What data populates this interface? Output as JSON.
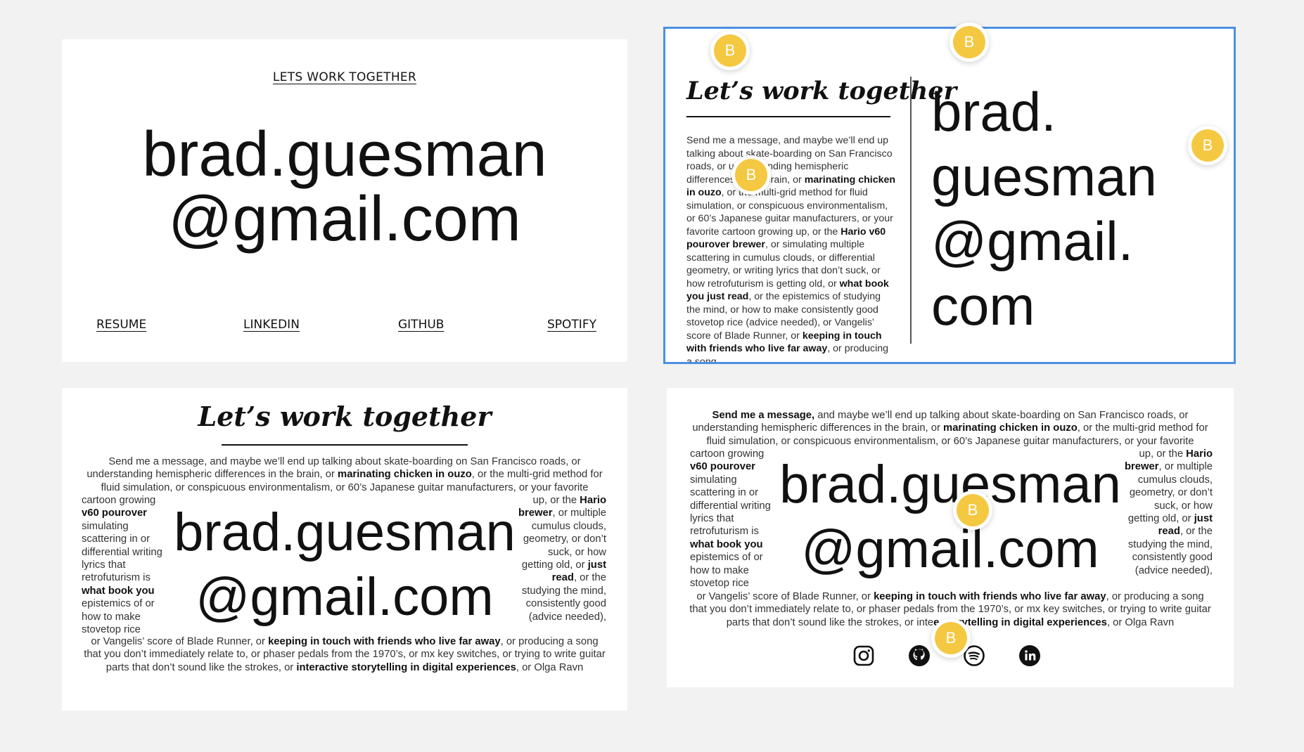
{
  "card1": {
    "top_link": "LETS WORK TOGETHER",
    "email_line1": "brad.guesman",
    "email_line2": "@gmail.com",
    "links": [
      "RESUME",
      "LINKEDIN",
      "GITHUB",
      "SPOTIFY"
    ]
  },
  "card2": {
    "title": "Let’s work together",
    "message": [
      {
        "t": "Send me a message, and maybe we’ll end up talking about skate-boarding on San Francisco roads, or understanding hemispheric differences in the brain, or "
      },
      {
        "b": "marinating chicken in ouzo"
      },
      {
        "t": ", or the multi-grid method for fluid simulation, or conspicuous environmentalism, or 60’s Japanese guitar manufacturers, or your favorite cartoon growing up, or the "
      },
      {
        "b": "Hario v60 pourover brewer"
      },
      {
        "t": ", or simulating multiple scattering in cumulus clouds, or differential geometry, or writing lyrics that don’t suck, or how retrofuturism is getting old, or "
      },
      {
        "b": "what book you just read"
      },
      {
        "t": ", or the epistemics of studying the mind, or how to make consistently good stovetop rice (advice needed), or Vangelis’ score of Blade Runner, or "
      },
      {
        "b": "keeping in touch with friends who live far away"
      },
      {
        "t": ", or producing a song"
      }
    ],
    "email_lines": [
      "brad.",
      "guesman",
      "@gmail.",
      "com"
    ]
  },
  "card3": {
    "title": "Let’s work together",
    "para_top": [
      {
        "t": "Send me a message, and maybe we’ll end up talking about skate-boarding on San Francisco roads, or understanding hemispheric differences in the brain, or "
      },
      {
        "b": "marinating chicken in ouzo"
      },
      {
        "t": ", or the multi-grid method for fluid simulation, or conspicuous environmentalism, or 60’s Japanese guitar manufacturers, or your favorite"
      }
    ],
    "side_left": [
      {
        "t": "cartoon growing "
      },
      {
        "b": "v60 pourover"
      },
      {
        "t": " simulating scattering in or differential writing lyrics that retrofuturism is "
      },
      {
        "b": "what book you"
      },
      {
        "t": " epistemics of or how to make stovetop rice"
      }
    ],
    "side_right": [
      {
        "t": "up, or the "
      },
      {
        "b": "Hario brewer"
      },
      {
        "t": ", or multiple cumulus clouds, geometry, or don’t suck, or how getting old, or "
      },
      {
        "b": "just read"
      },
      {
        "t": ", or the studying the mind, consistently good (advice needed),"
      }
    ],
    "para_bottom": [
      {
        "t": "or Vangelis’ score of Blade Runner, or "
      },
      {
        "b": "keeping in touch with friends who live far away"
      },
      {
        "t": ", or producing a song that you don’t immediately relate to, or phaser pedals from the 1970’s, or mx key switches, or trying to write guitar parts that don’t sound like the strokes, or "
      },
      {
        "b": "interactive storytelling in digital experiences"
      },
      {
        "t": ", or Olga Ravn"
      }
    ],
    "email_line1": "brad.guesman",
    "email_line2": "@gmail.com"
  },
  "card4": {
    "para_top": [
      {
        "b": "Send me a message,"
      },
      {
        "t": " and maybe we’ll end up talking about skate-boarding on San Francisco roads, or understanding hemispheric differences in the brain, or "
      },
      {
        "b": "marinating chicken in ouzo"
      },
      {
        "t": ", or the multi-grid method for fluid simulation, or conspicuous environmentalism, or 60’s Japanese guitar manufacturers, or your favorite"
      }
    ],
    "side_left": [
      {
        "t": "cartoon growing "
      },
      {
        "b": "v60 pourover"
      },
      {
        "t": " simulating scattering in or differential writing lyrics that retrofuturism is "
      },
      {
        "b": "what book you"
      },
      {
        "t": " epistemics of or how to make stovetop rice"
      }
    ],
    "side_right": [
      {
        "t": "up, or the "
      },
      {
        "b": "Hario brewer"
      },
      {
        "t": ", or multiple cumulus clouds, geometry, or don’t suck, or how getting old, or "
      },
      {
        "b": "just read"
      },
      {
        "t": ", or the studying the mind, consistently good (advice needed),"
      }
    ],
    "para_bottom": [
      {
        "t": "or Vangelis’ score of Blade Runner, or "
      },
      {
        "b": "keeping in touch with friends who live far away"
      },
      {
        "t": ", or producing a song that you don’t immediately relate to, or phaser pedals from the 1970’s, or mx key switches, or trying to write guitar parts that don’t sound like the strokes, or inte"
      },
      {
        "b": "e storytelling in digital experiences"
      },
      {
        "t": ", or Olga Ravn"
      }
    ],
    "email_line1": "brad.guesman",
    "email_line2": "@gmail.com",
    "icons": [
      "instagram-icon",
      "github-icon",
      "spotify-icon",
      "linkedin-icon"
    ]
  },
  "avatar_letter": "B",
  "colors": {
    "selection": "#4a90e2",
    "avatar": "#f5c842"
  }
}
